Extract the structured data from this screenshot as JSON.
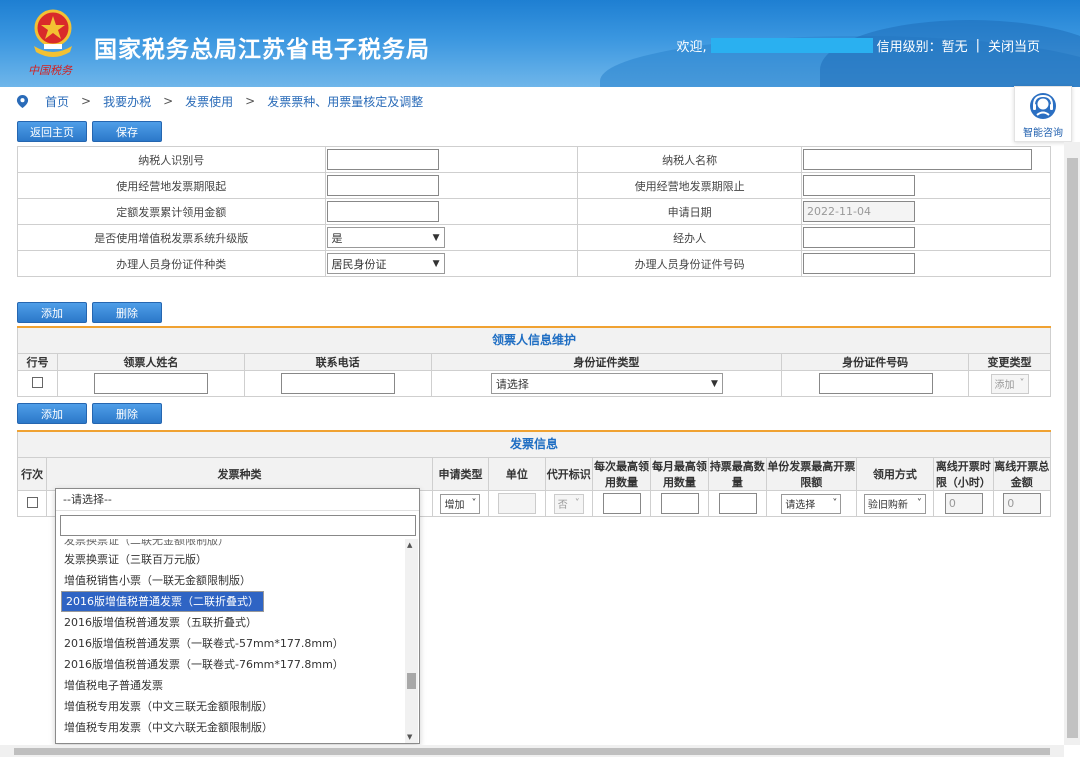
{
  "header": {
    "title": "国家税务总局江苏省电子税务局",
    "logo_text": "中国税务",
    "welcome": "欢迎,",
    "credit_label": "信用级别：暂无",
    "close_label": "关闭当页",
    "separator": "|"
  },
  "breadcrumb": {
    "items": [
      "首页",
      "我要办税",
      "发票使用",
      "发票票种、用票量核定及调整"
    ],
    "separator": ">"
  },
  "consult": {
    "label": "智能咨询"
  },
  "toolbar": {
    "back_label": "返回主页",
    "save_label": "保存"
  },
  "form": {
    "taxpayer_id_label": "纳税人识别号",
    "taxpayer_name_label": "纳税人名称",
    "period_start_label": "使用经营地发票期限起",
    "period_end_label": "使用经营地发票期限止",
    "quota_amount_label": "定额发票累计领用金额",
    "apply_date_label": "申请日期",
    "apply_date_value": "2022-11-04",
    "upgrade_label": "是否使用增值税发票系统升级版",
    "upgrade_value": "是",
    "handler_label": "经办人",
    "id_type_label": "办理人员身份证件种类",
    "id_type_value": "居民身份证",
    "id_number_label": "办理人员身份证件号码"
  },
  "recipient_section": {
    "add_label": "添加",
    "delete_label": "删除",
    "title": "领票人信息维护",
    "headers": [
      "行号",
      "领票人姓名",
      "联系电话",
      "身份证件类型",
      "身份证件号码",
      "变更类型"
    ],
    "id_type_placeholder": "请选择",
    "change_type_value": "添加"
  },
  "invoice_section": {
    "add_label": "添加",
    "delete_label": "删除",
    "title": "发票信息",
    "headers": [
      "行次",
      "发票种类",
      "申请类型",
      "单位",
      "代开标识",
      "每次最高领用数量",
      "每月最高领用数量",
      "持票最高数量",
      "单份发票最高开票限额",
      "领用方式",
      "离线开票时限（小时）",
      "离线开票总金额"
    ],
    "row": {
      "invoice_type_value": "--请选择--",
      "apply_type_value": "增加",
      "agent_flag_value": "否",
      "limit_value": "请选择",
      "receive_method_value": "验旧购新",
      "offline_hours_value": "0",
      "offline_amount_value": "0"
    }
  },
  "dropdown": {
    "selected_index": 3,
    "items": [
      "发票换票证（二联无金额限制版）",
      "发票换票证（三联百万元版）",
      "增值税销售小票（一联无金额限制版）",
      "2016版增值税普通发票（二联折叠式）",
      "2016版增值税普通发票（五联折叠式）",
      "2016版增值税普通发票（一联卷式-57mm*177.8mm）",
      "2016版增值税普通发票（一联卷式-76mm*177.8mm）",
      "增值税电子普通发票",
      "增值税专用发票（中文三联无金额限制版）",
      "增值税专用发票（中文六联无金额限制版）"
    ]
  }
}
